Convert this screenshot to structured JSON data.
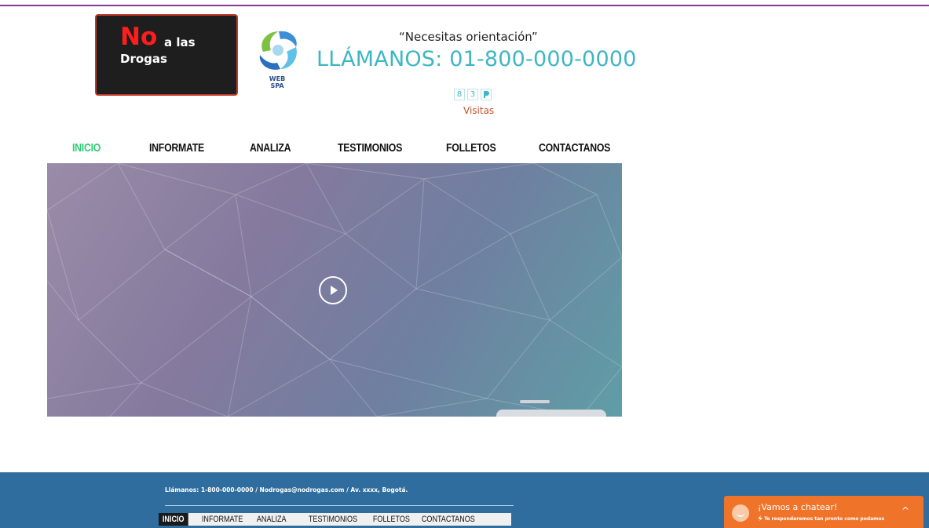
{
  "header": {
    "logo": {
      "no": "No",
      "a_las": "a las",
      "drogas": "Drogas"
    },
    "spa_logo": {
      "line1": "WEB",
      "line2": "SPA"
    },
    "tagline": "“Necesitas orientación”",
    "phone": "LLÁMANOS: 01-800-000-0000",
    "counter": {
      "digits": [
        "8",
        "3"
      ],
      "label": "Visitas"
    }
  },
  "nav": {
    "items": [
      {
        "label": "INICIO",
        "active": true
      },
      {
        "label": "INFORMATE",
        "active": false
      },
      {
        "label": "ANALIZA",
        "active": false
      },
      {
        "label": "TESTIMONIOS",
        "active": false
      },
      {
        "label": "FOLLETOS",
        "active": false
      },
      {
        "label": "CONTACTANOS",
        "active": false
      }
    ]
  },
  "hero": {
    "play_icon": "play-circle-icon"
  },
  "footer": {
    "info": "Llámanos: 1-800-000-0000  /  Nodrogas@nodrogas.com  / Av. xxxx, Bogotá.",
    "nav": [
      "INICIO",
      "INFORMATE",
      "ANALIZA",
      "TESTIMONIOS",
      "FOLLETOS",
      "CONTACTANOS"
    ]
  },
  "chat": {
    "title": "¡Vamos a chatear!",
    "subtitle": "Te responderemos tan pronto como podamos",
    "chevron": "^"
  },
  "colors": {
    "accent_purple": "#8a3a9a",
    "phone_teal": "#3fb6c4",
    "nav_active_green": "#2ecc71",
    "footer_blue": "#2e6d9e",
    "chat_orange": "#f0732a",
    "logo_red": "#ff1e1e"
  }
}
